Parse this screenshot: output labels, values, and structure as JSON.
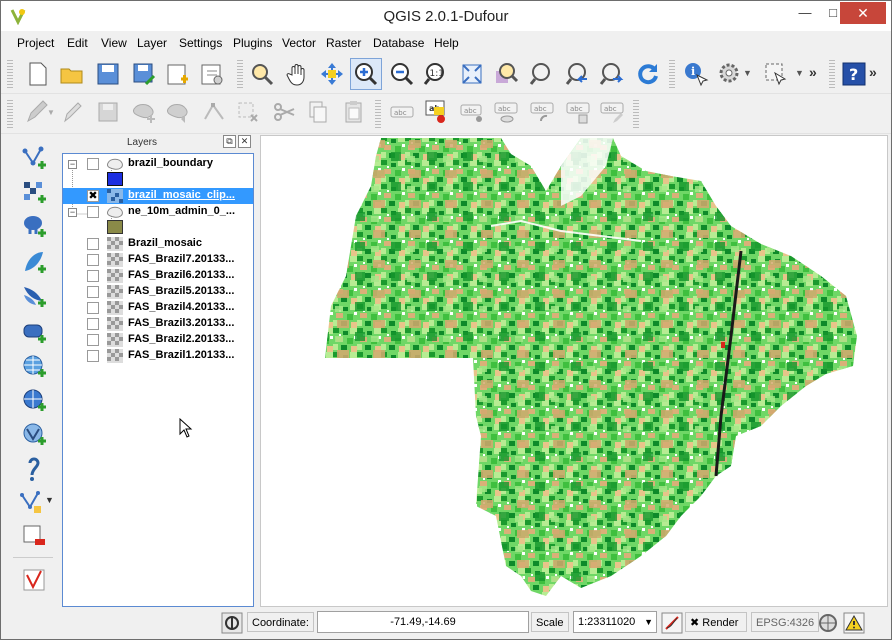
{
  "window": {
    "title": "QGIS 2.0.1-Dufour",
    "min": "—",
    "max": "□",
    "close": "✕"
  },
  "menu": [
    "Project",
    "Edit",
    "View",
    "Layer",
    "Settings",
    "Plugins",
    "Vector",
    "Raster",
    "Database",
    "Help"
  ],
  "toolbar1": [
    "new-project-icon",
    "open-project-icon",
    "save-project-icon",
    "save-as-icon",
    "new-print-composer-icon",
    "composer-manager-icon",
    "pan-to-selection-icon",
    "pan-icon",
    "pan-to-selection-icon",
    "zoom-in-icon",
    "zoom-out-icon",
    "zoom-1to1-icon",
    "zoom-full-icon",
    "zoom-to-layer-icon",
    "zoom-to-selection-icon",
    "zoom-last-icon",
    "zoom-next-icon",
    "refresh-icon",
    "identify-icon",
    "measure-icon",
    "select-icon",
    "more-icon",
    "help-icon"
  ],
  "toolbar2": [
    "current-edits-icon",
    "toggle-editing-icon",
    "save-edits-icon",
    "add-feature-icon",
    "move-feature-icon",
    "node-tool-icon",
    "delete-selected-icon",
    "cut-icon",
    "copy-icon",
    "paste-icon",
    "label-icon",
    "layer-labeling-icon",
    "move-label-icon",
    "show-hide-label-icon",
    "rotate-label-icon",
    "change-label-icon",
    "label-edit-icon"
  ],
  "left_toolbar": [
    "add-vector-layer-icon",
    "add-raster-layer-icon",
    "add-postgis-layer-icon",
    "add-spatialite-layer-icon",
    "add-mssql-layer-icon",
    "add-oracle-layer-icon",
    "add-wms-layer-icon",
    "add-wcs-layer-icon",
    "add-wfs-layer-icon",
    "add-delimited-text-icon",
    "new-shapefile-icon",
    "remove-layer-icon",
    "gps-tools-icon"
  ],
  "layers_panel": {
    "title": "Layers",
    "float": "⧉",
    "close": "✕"
  },
  "layers": [
    {
      "name": "brazil_boundary",
      "checked": false,
      "expanded": true,
      "type": "vector",
      "legend_color": "#1c2ee0"
    },
    {
      "name": "brazil_mosaic_clip...",
      "checked": true,
      "selected": true,
      "type": "raster"
    },
    {
      "name": "ne_10m_admin_0_...",
      "checked": false,
      "expanded": true,
      "type": "vector",
      "legend_color": "#8a8a48"
    },
    {
      "name": "Brazil_mosaic",
      "checked": false,
      "type": "raster"
    },
    {
      "name": "FAS_Brazil7.20133...",
      "checked": false,
      "type": "raster"
    },
    {
      "name": "FAS_Brazil6.20133...",
      "checked": false,
      "type": "raster"
    },
    {
      "name": "FAS_Brazil5.20133...",
      "checked": false,
      "type": "raster"
    },
    {
      "name": "FAS_Brazil4.20133...",
      "checked": false,
      "type": "raster"
    },
    {
      "name": "FAS_Brazil3.20133...",
      "checked": false,
      "type": "raster"
    },
    {
      "name": "FAS_Brazil2.20133...",
      "checked": false,
      "type": "raster"
    },
    {
      "name": "FAS_Brazil1.20133...",
      "checked": false,
      "type": "raster"
    }
  ],
  "status": {
    "coordinate_label": "Coordinate:",
    "coordinate_value": "-71.49,-14.69",
    "scale_label": "Scale",
    "scale_value": "1:23311020",
    "render_label": "Render",
    "render_checked": true,
    "crs": "EPSG:4326"
  },
  "colors": {
    "raster_light": "#7ae36e",
    "raster_mid": "#3fbf3f",
    "raster_dark": "#0e8a2a",
    "raster_tan": "#d9b078",
    "selection": "#3399ff"
  }
}
